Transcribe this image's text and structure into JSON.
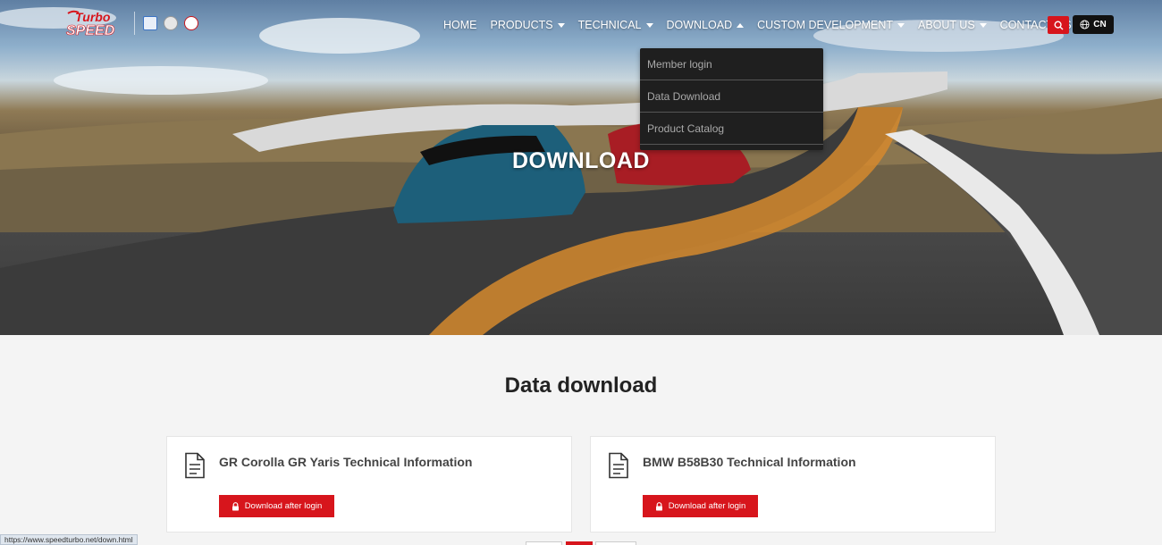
{
  "header": {
    "logo_text": "Turbo SPEED",
    "nav": [
      {
        "label": "HOME",
        "caret": "none"
      },
      {
        "label": "PRODUCTS",
        "caret": "down"
      },
      {
        "label": "TECHNICAL",
        "caret": "down"
      },
      {
        "label": "DOWNLOAD",
        "caret": "up"
      },
      {
        "label": "CUSTOM DEVELOPMENT",
        "caret": "down"
      },
      {
        "label": "ABOUT US",
        "caret": "down"
      },
      {
        "label": "CONTACT US",
        "caret": "down"
      }
    ],
    "lang_label": "CN"
  },
  "dropdown": {
    "items": [
      "Member login",
      "Data Download",
      "Product Catalog"
    ]
  },
  "hero": {
    "title": "DOWNLOAD"
  },
  "section": {
    "title": "Data download",
    "cards": [
      {
        "title": "GR Corolla GR Yaris Technical Information",
        "button": "Download after login"
      },
      {
        "title": "BMW B58B30 Technical Information",
        "button": "Download after login"
      }
    ]
  },
  "status_bar": {
    "url": "https://www.speedturbo.net/down.html"
  },
  "colors": {
    "accent": "#d7151c",
    "dropdown_bg": "#1f1f1f",
    "page_bg": "#f4f4f4"
  },
  "icons": [
    "search-icon",
    "globe-icon",
    "document-icon",
    "lock-icon"
  ]
}
